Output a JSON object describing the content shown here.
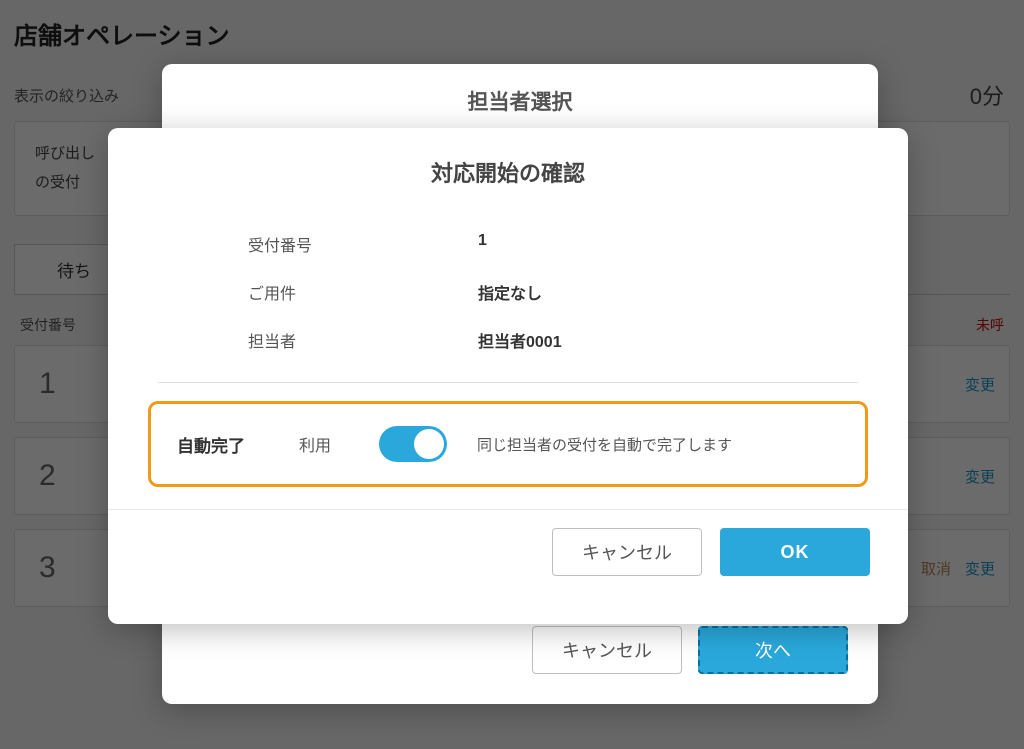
{
  "bg": {
    "page_title": "店舗オペレーション",
    "filter_label": "表示の絞り込み",
    "wait_suffix": "0分",
    "card": {
      "line1_prefix": "呼び出し",
      "line2_prefix": "の受付"
    },
    "tab_waiting": "待ち",
    "col_left": "受付番号",
    "col_right": "未呼",
    "rows": [
      {
        "num": "1",
        "cancel": "",
        "change": "変更"
      },
      {
        "num": "2",
        "cancel": "",
        "change": "変更"
      },
      {
        "num": "3",
        "cancel": "取消",
        "change": "変更"
      }
    ]
  },
  "modal_back": {
    "title": "担当者選択",
    "cancel": "キャンセル",
    "next": "次へ"
  },
  "modal_front": {
    "title": "対応開始の確認",
    "rows": {
      "receipt_label": "受付番号",
      "receipt_value": "1",
      "purpose_label": "ご用件",
      "purpose_value": "指定なし",
      "staff_label": "担当者",
      "staff_value": "担当者0001"
    },
    "auto": {
      "title": "自動完了",
      "mode": "利用",
      "enabled": true,
      "desc": "同じ担当者の受付を自動で完了します"
    },
    "cancel": "キャンセル",
    "ok": "OK"
  }
}
